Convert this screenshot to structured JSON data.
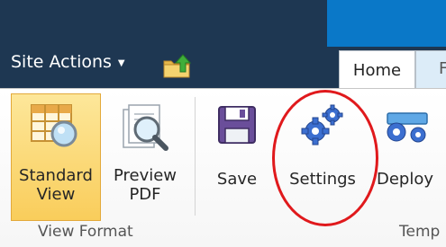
{
  "header": {
    "site_actions_label": "Site Actions",
    "caret": "▼"
  },
  "tabs": [
    {
      "label": "Home",
      "active": true
    },
    {
      "label": "F",
      "active": false
    }
  ],
  "ribbon": {
    "buttons": {
      "standard_view": {
        "line1": "Standard",
        "line2": "View",
        "icon": "standard-view-icon",
        "selected": true
      },
      "preview_pdf": {
        "line1": "Preview",
        "line2": "PDF",
        "icon": "preview-pdf-icon"
      },
      "save": {
        "label": "Save",
        "icon": "save-icon"
      },
      "settings": {
        "label": "Settings",
        "icon": "settings-icon"
      },
      "deploy": {
        "label": "Deploy",
        "icon": "deploy-icon"
      }
    },
    "groups": {
      "view_format": "View Format",
      "template": "Temp"
    }
  },
  "annotation": {
    "color": "#e0191c"
  },
  "colors": {
    "top_bar": "#1e3752",
    "top_bar_accent": "#0a78c8",
    "selected_button": "#f9cd5b"
  }
}
